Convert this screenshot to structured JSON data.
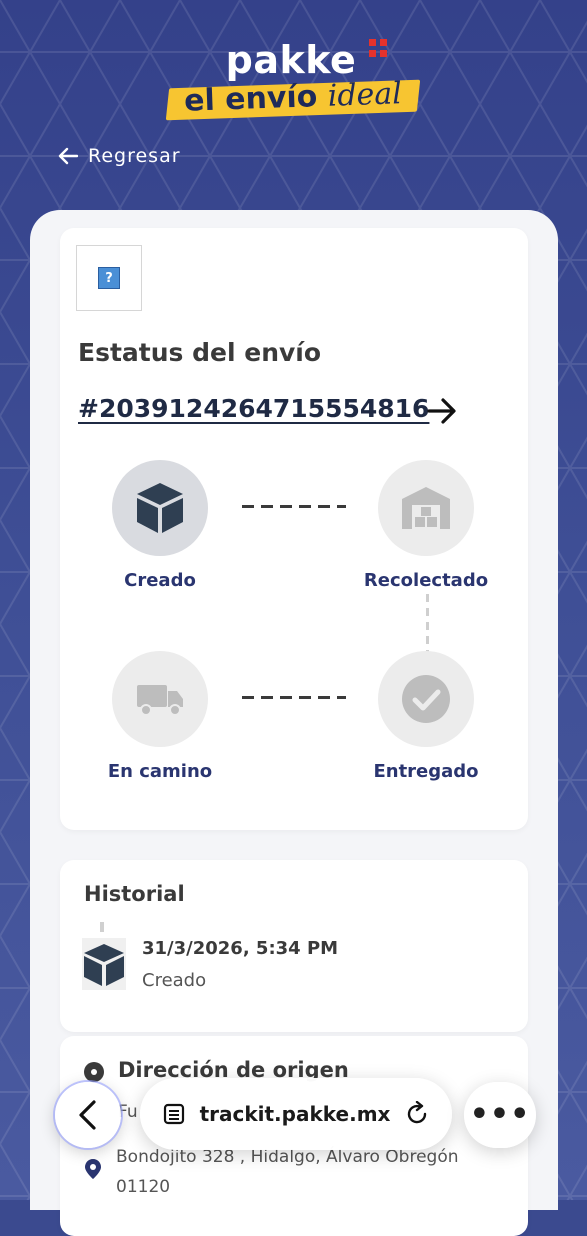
{
  "brand": {
    "name": "pakke",
    "tagline_main": "el envío",
    "tagline_em": "ideal",
    "colors": {
      "background": "#3b4a8f",
      "accent_yellow": "#f7c531",
      "accent_red": "#e4322c",
      "step_label": "#2a3570"
    }
  },
  "nav": {
    "back_label": "Regresar"
  },
  "status": {
    "title": "Estatus del envío",
    "tracking_number": "#2039124264715554816",
    "steps": [
      {
        "label": "Creado",
        "icon": "box-icon",
        "active": true
      },
      {
        "label": "Recolectado",
        "icon": "warehouse-icon",
        "active": false
      },
      {
        "label": "En camino",
        "icon": "truck-icon",
        "active": false
      },
      {
        "label": "Entregado",
        "icon": "check-circle-icon",
        "active": false
      }
    ]
  },
  "history": {
    "title": "Historial",
    "entries": [
      {
        "date": "31/3/2026, 5:34 PM",
        "status": "Creado",
        "icon": "box-icon"
      }
    ]
  },
  "origin": {
    "title": "Dirección de origen",
    "subtitle": "Fu",
    "address_line1": "Bondojito 328 , Hidalgo, Álvaro Obregón",
    "address_line2": "01120"
  },
  "browser": {
    "url": "trackit.pakke.mx",
    "more_label": "•••"
  }
}
